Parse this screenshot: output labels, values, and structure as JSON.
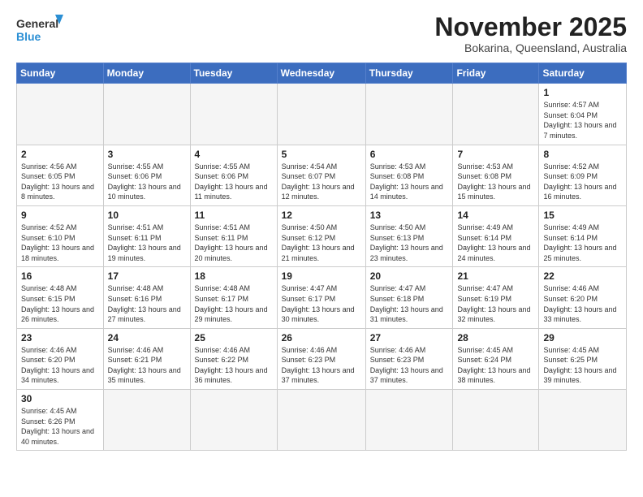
{
  "header": {
    "logo_general": "General",
    "logo_blue": "Blue",
    "month_title": "November 2025",
    "subtitle": "Bokarina, Queensland, Australia"
  },
  "weekdays": [
    "Sunday",
    "Monday",
    "Tuesday",
    "Wednesday",
    "Thursday",
    "Friday",
    "Saturday"
  ],
  "weeks": [
    [
      {
        "day": "",
        "info": ""
      },
      {
        "day": "",
        "info": ""
      },
      {
        "day": "",
        "info": ""
      },
      {
        "day": "",
        "info": ""
      },
      {
        "day": "",
        "info": ""
      },
      {
        "day": "",
        "info": ""
      },
      {
        "day": "1",
        "info": "Sunrise: 4:57 AM\nSunset: 6:04 PM\nDaylight: 13 hours and 7 minutes."
      }
    ],
    [
      {
        "day": "2",
        "info": "Sunrise: 4:56 AM\nSunset: 6:05 PM\nDaylight: 13 hours and 8 minutes."
      },
      {
        "day": "3",
        "info": "Sunrise: 4:55 AM\nSunset: 6:06 PM\nDaylight: 13 hours and 10 minutes."
      },
      {
        "day": "4",
        "info": "Sunrise: 4:55 AM\nSunset: 6:06 PM\nDaylight: 13 hours and 11 minutes."
      },
      {
        "day": "5",
        "info": "Sunrise: 4:54 AM\nSunset: 6:07 PM\nDaylight: 13 hours and 12 minutes."
      },
      {
        "day": "6",
        "info": "Sunrise: 4:53 AM\nSunset: 6:08 PM\nDaylight: 13 hours and 14 minutes."
      },
      {
        "day": "7",
        "info": "Sunrise: 4:53 AM\nSunset: 6:08 PM\nDaylight: 13 hours and 15 minutes."
      },
      {
        "day": "8",
        "info": "Sunrise: 4:52 AM\nSunset: 6:09 PM\nDaylight: 13 hours and 16 minutes."
      }
    ],
    [
      {
        "day": "9",
        "info": "Sunrise: 4:52 AM\nSunset: 6:10 PM\nDaylight: 13 hours and 18 minutes."
      },
      {
        "day": "10",
        "info": "Sunrise: 4:51 AM\nSunset: 6:11 PM\nDaylight: 13 hours and 19 minutes."
      },
      {
        "day": "11",
        "info": "Sunrise: 4:51 AM\nSunset: 6:11 PM\nDaylight: 13 hours and 20 minutes."
      },
      {
        "day": "12",
        "info": "Sunrise: 4:50 AM\nSunset: 6:12 PM\nDaylight: 13 hours and 21 minutes."
      },
      {
        "day": "13",
        "info": "Sunrise: 4:50 AM\nSunset: 6:13 PM\nDaylight: 13 hours and 23 minutes."
      },
      {
        "day": "14",
        "info": "Sunrise: 4:49 AM\nSunset: 6:14 PM\nDaylight: 13 hours and 24 minutes."
      },
      {
        "day": "15",
        "info": "Sunrise: 4:49 AM\nSunset: 6:14 PM\nDaylight: 13 hours and 25 minutes."
      }
    ],
    [
      {
        "day": "16",
        "info": "Sunrise: 4:48 AM\nSunset: 6:15 PM\nDaylight: 13 hours and 26 minutes."
      },
      {
        "day": "17",
        "info": "Sunrise: 4:48 AM\nSunset: 6:16 PM\nDaylight: 13 hours and 27 minutes."
      },
      {
        "day": "18",
        "info": "Sunrise: 4:48 AM\nSunset: 6:17 PM\nDaylight: 13 hours and 29 minutes."
      },
      {
        "day": "19",
        "info": "Sunrise: 4:47 AM\nSunset: 6:17 PM\nDaylight: 13 hours and 30 minutes."
      },
      {
        "day": "20",
        "info": "Sunrise: 4:47 AM\nSunset: 6:18 PM\nDaylight: 13 hours and 31 minutes."
      },
      {
        "day": "21",
        "info": "Sunrise: 4:47 AM\nSunset: 6:19 PM\nDaylight: 13 hours and 32 minutes."
      },
      {
        "day": "22",
        "info": "Sunrise: 4:46 AM\nSunset: 6:20 PM\nDaylight: 13 hours and 33 minutes."
      }
    ],
    [
      {
        "day": "23",
        "info": "Sunrise: 4:46 AM\nSunset: 6:20 PM\nDaylight: 13 hours and 34 minutes."
      },
      {
        "day": "24",
        "info": "Sunrise: 4:46 AM\nSunset: 6:21 PM\nDaylight: 13 hours and 35 minutes."
      },
      {
        "day": "25",
        "info": "Sunrise: 4:46 AM\nSunset: 6:22 PM\nDaylight: 13 hours and 36 minutes."
      },
      {
        "day": "26",
        "info": "Sunrise: 4:46 AM\nSunset: 6:23 PM\nDaylight: 13 hours and 37 minutes."
      },
      {
        "day": "27",
        "info": "Sunrise: 4:46 AM\nSunset: 6:23 PM\nDaylight: 13 hours and 37 minutes."
      },
      {
        "day": "28",
        "info": "Sunrise: 4:45 AM\nSunset: 6:24 PM\nDaylight: 13 hours and 38 minutes."
      },
      {
        "day": "29",
        "info": "Sunrise: 4:45 AM\nSunset: 6:25 PM\nDaylight: 13 hours and 39 minutes."
      }
    ],
    [
      {
        "day": "30",
        "info": "Sunrise: 4:45 AM\nSunset: 6:26 PM\nDaylight: 13 hours and 40 minutes."
      },
      {
        "day": "",
        "info": ""
      },
      {
        "day": "",
        "info": ""
      },
      {
        "day": "",
        "info": ""
      },
      {
        "day": "",
        "info": ""
      },
      {
        "day": "",
        "info": ""
      },
      {
        "day": "",
        "info": ""
      }
    ]
  ]
}
